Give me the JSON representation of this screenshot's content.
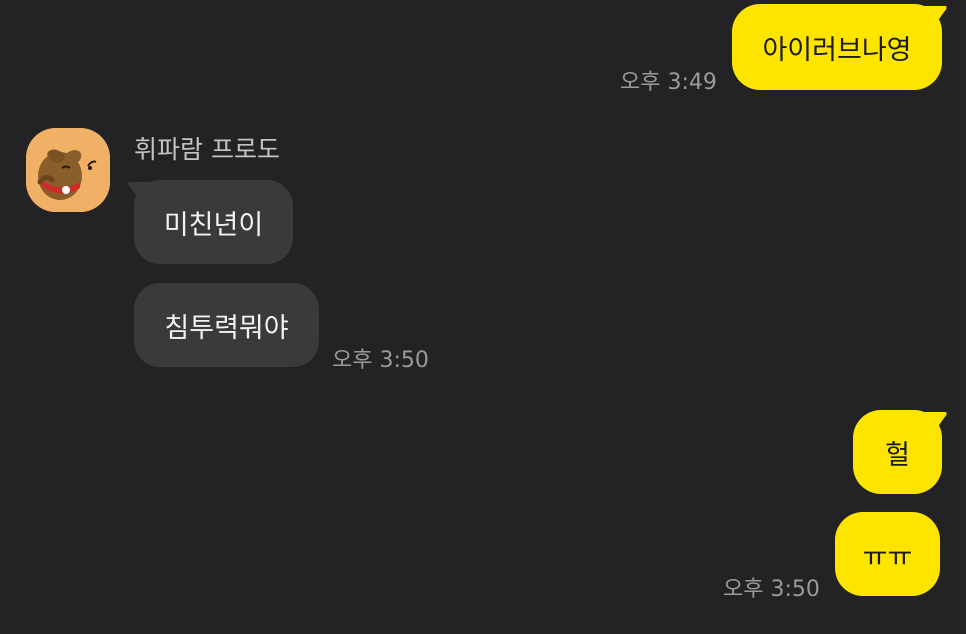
{
  "conversation": {
    "messages": [
      {
        "sender": "me",
        "text": "아이러브나영",
        "time": "오후 3:49"
      },
      {
        "sender": "them",
        "text": "미친년이"
      },
      {
        "sender": "them",
        "text": "침투력뭐야",
        "time": "오후 3:50"
      },
      {
        "sender": "me",
        "text": "헐"
      },
      {
        "sender": "me",
        "text": "ㅠㅠ",
        "time": "오후 3:50"
      }
    ],
    "other_user": {
      "name": "휘파람 프로도",
      "avatar_icon": "frodo-dog-avatar-icon"
    }
  },
  "colors": {
    "background": "#232326",
    "my_bubble": "#fee500",
    "their_bubble": "#3a3a3c",
    "timestamp": "#9a9a9c"
  }
}
